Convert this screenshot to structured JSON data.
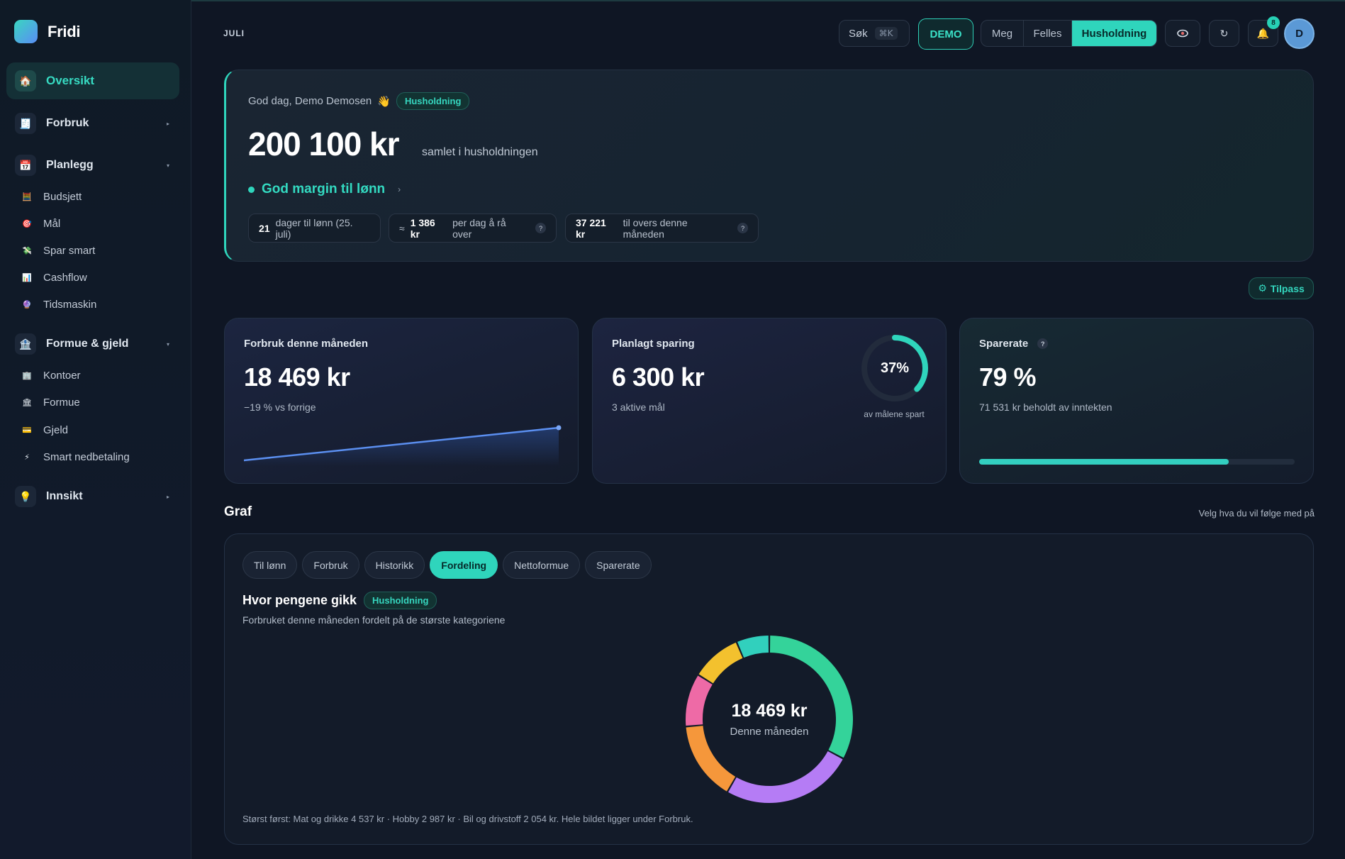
{
  "app": {
    "name": "Fridi"
  },
  "sidebar": {
    "top": {
      "label": "Oversikt",
      "icon": "house-icon"
    },
    "groups": [
      {
        "label": "Forbruk",
        "icon": "receipt-icon"
      },
      {
        "label": "Planlegg",
        "icon": "calendar-icon",
        "items": [
          {
            "label": "Budsjett",
            "icon": "abacus-icon"
          },
          {
            "label": "Mål",
            "icon": "target-icon"
          },
          {
            "label": "Spar smart",
            "icon": "money-wings-icon"
          },
          {
            "label": "Cashflow",
            "icon": "chart-icon"
          },
          {
            "label": "Tidsmaskin",
            "icon": "crystal-ball-icon"
          }
        ]
      },
      {
        "label": "Formue & gjeld",
        "icon": "bank-icon",
        "items": [
          {
            "label": "Kontoer",
            "icon": "building-icon"
          },
          {
            "label": "Formue",
            "icon": "classical-building-icon"
          },
          {
            "label": "Gjeld",
            "icon": "credit-card-icon"
          },
          {
            "label": "Smart nedbetaling",
            "icon": "lightning-icon"
          }
        ]
      },
      {
        "label": "Innsikt",
        "icon": "bulb-icon"
      }
    ]
  },
  "topbar": {
    "month": "JULI",
    "search_label": "Søk",
    "search_shortcut": "⌘K",
    "demo_label": "DEMO",
    "scope_tabs": [
      "Meg",
      "Felles",
      "Husholdning"
    ],
    "notification_count": "8",
    "avatar_initial": "D"
  },
  "hero": {
    "greeting": "God dag, Demo Demosen",
    "scope_badge": "Husholdning",
    "amount": "200 100 kr",
    "amount_caption": "samlet i husholdningen",
    "status": "God margin til lønn",
    "chips": [
      {
        "value": "21",
        "text": "dager til lønn (25. juli)"
      },
      {
        "prefix": "≈",
        "value": "1 386 kr",
        "text": "per dag å rå over"
      },
      {
        "value": "37 221 kr",
        "text": "til overs denne måneden"
      }
    ]
  },
  "customize_label": "Tilpass",
  "cards": {
    "spending": {
      "title": "Forbruk denne måneden",
      "value": "18 469 kr",
      "sub": "−19 % vs forrige"
    },
    "saving": {
      "title": "Planlagt sparing",
      "value": "6 300 kr",
      "sub": "3 aktive mål",
      "ring_pct": "37%",
      "ring_value": 0.37,
      "ring_caption": "av målene spart"
    },
    "rate": {
      "title": "Sparerate",
      "value": "79 %",
      "sub": "71 531 kr beholdt av inntekten",
      "progress": 0.79
    }
  },
  "graph": {
    "section_title": "Graf",
    "section_hint": "Velg hva du vil følge med på",
    "tabs": [
      "Til lønn",
      "Forbruk",
      "Historikk",
      "Fordeling",
      "Nettoformue",
      "Sparerate"
    ],
    "active_tab": "Fordeling",
    "title": "Hvor pengene gikk",
    "badge": "Husholdning",
    "subtitle": "Forbruket denne måneden fordelt på de største kategoriene",
    "center_value": "18 469 kr",
    "center_label": "Denne måneden",
    "footer": "Størst først: Mat og drikke 4 537 kr · Hobby 2 987 kr · Bil og drivstoff 2 054 kr. Hele bildet ligger under Forbruk."
  },
  "colors": {
    "accent": "#2fd5bc",
    "donut": [
      "#34d39a",
      "#b57cf5",
      "#f5973b",
      "#ee6aa6",
      "#f3c12e",
      "#31d0bd"
    ]
  }
}
